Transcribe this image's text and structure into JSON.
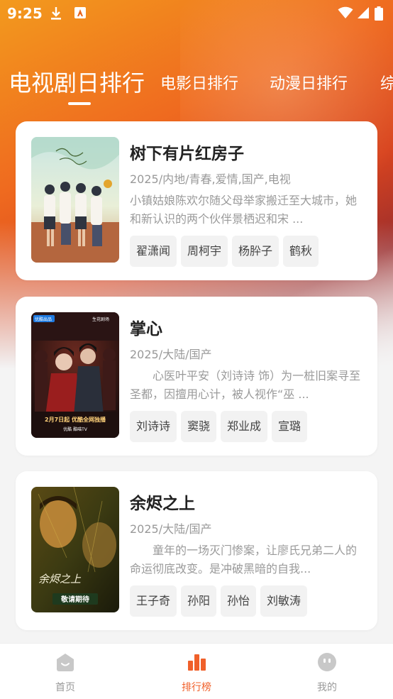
{
  "status_bar": {
    "time": "9:25"
  },
  "tabs": [
    {
      "label": "电视剧日排行",
      "active": true
    },
    {
      "label": "电影日排行"
    },
    {
      "label": "动漫日排行"
    },
    {
      "label": "综"
    }
  ],
  "items": [
    {
      "title": "树下有片红房子",
      "meta": "2025/内地/青春,爱情,国产,电视",
      "desc": "小镇姑娘陈欢尔随父母举家搬迁至大城市，她和新认识的两个伙伴景栖迟和宋 ...",
      "actors": [
        "翟潇闻",
        "周柯宇",
        "杨肸子",
        "鹤秋"
      ]
    },
    {
      "title": "掌心",
      "meta": "2025/大陆/国产",
      "desc": "　　心医叶平安（刘诗诗 饰）为一桩旧案寻至圣都，因擅用心计，被人视作“巫 ...",
      "actors": [
        "刘诗诗",
        "窦骁",
        "郑业成",
        "宣璐"
      ],
      "poster_text": {
        "badge_left": "优酷出品",
        "badge_right": "生花剧场",
        "date_line": "2月7日起 优酷全网独播",
        "logos": "优酷  酷喵TV"
      }
    },
    {
      "title": "余烬之上",
      "meta": "2025/大陆/国产",
      "desc": "　　童年的一场灭门惨案，让廖氏兄弟二人的命运彻底改变。是冲破黑暗的自我...",
      "actors": [
        "王子奇",
        "孙阳",
        "孙怡",
        "刘敏涛"
      ],
      "poster_text": {
        "logo": "余烬之上",
        "coming": "敬请期待"
      }
    }
  ],
  "bottom_nav": [
    {
      "label": "首页",
      "icon": "home-icon"
    },
    {
      "label": "排行榜",
      "icon": "ranking-icon",
      "active": true
    },
    {
      "label": "我的",
      "icon": "profile-icon"
    }
  ],
  "colors": {
    "accent": "#f0602a",
    "inactive": "#999999"
  }
}
